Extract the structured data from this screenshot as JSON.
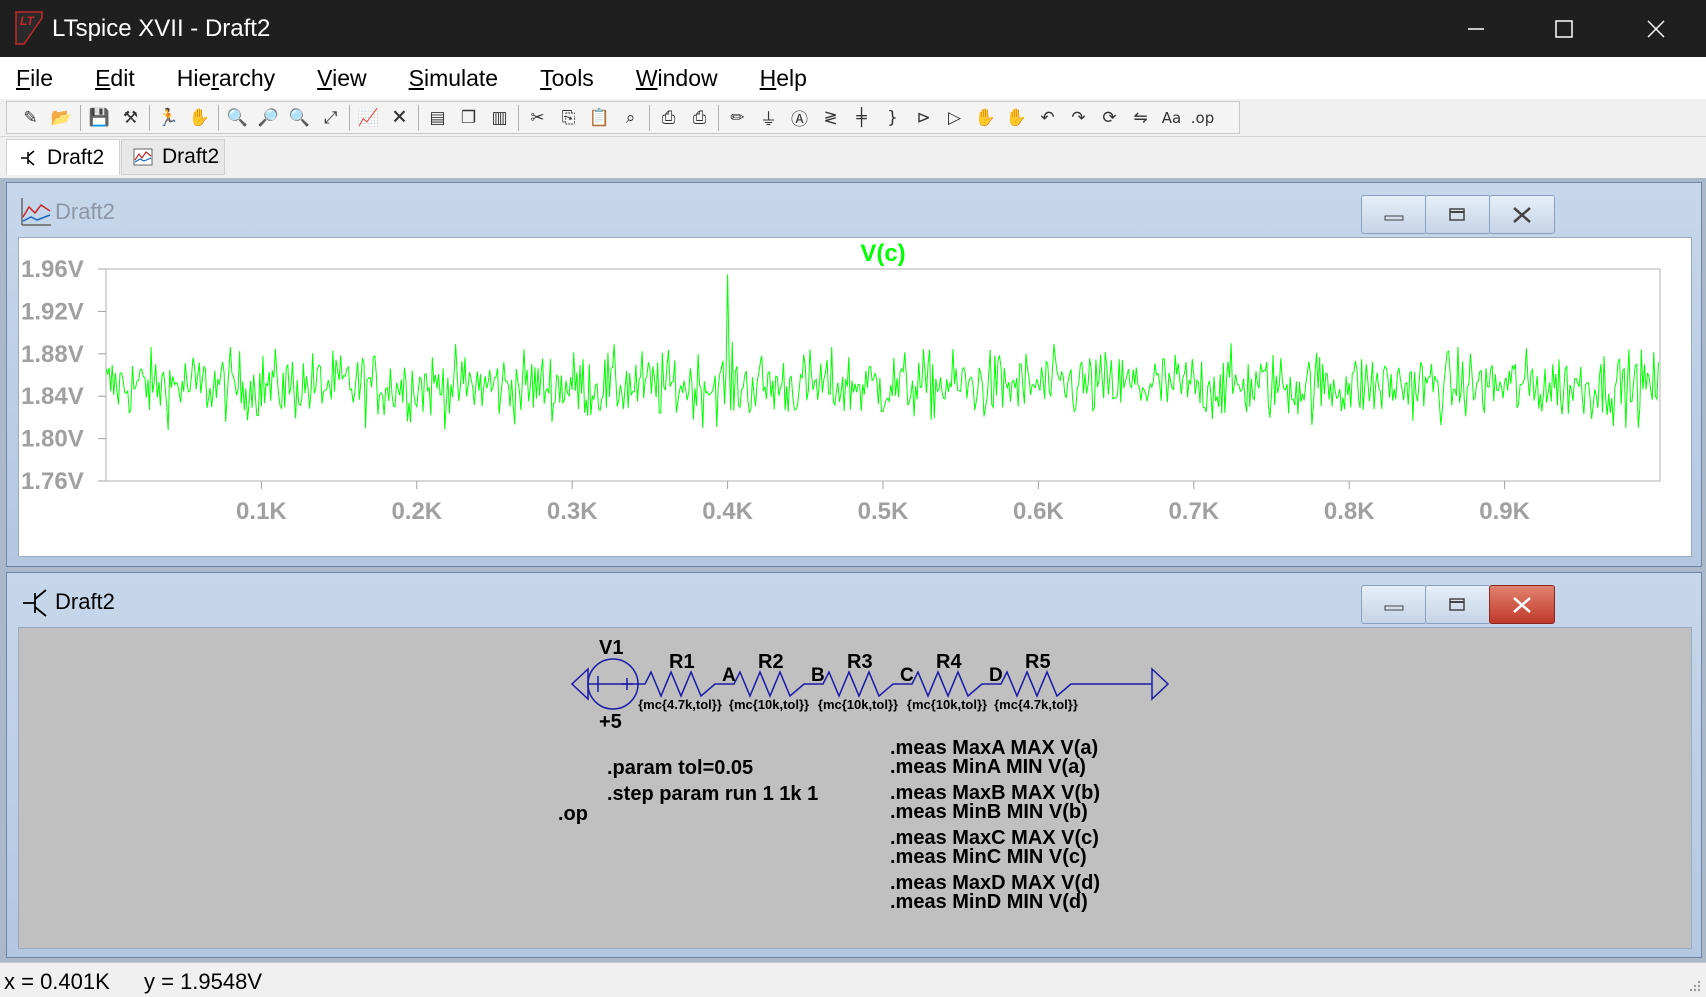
{
  "window": {
    "title": "LTspice XVII - Draft2"
  },
  "menu": [
    {
      "u": "F",
      "rest": "ile"
    },
    {
      "u": "E",
      "rest": "dit"
    },
    {
      "pre": "Hie",
      "u": "r",
      "rest": "archy"
    },
    {
      "u": "V",
      "rest": "iew"
    },
    {
      "u": "S",
      "rest": "imulate"
    },
    {
      "u": "T",
      "rest": "ools"
    },
    {
      "u": "W",
      "rest": "indow"
    },
    {
      "u": "H",
      "rest": "elp"
    }
  ],
  "toolbar": {
    "buttons": [
      "new-schematic-icon",
      "open-icon",
      "save-icon",
      "control-panel-icon",
      "run-icon",
      "halt-icon",
      "zoom-in-icon",
      "zoom-area-icon",
      "zoom-out-icon",
      "zoom-fit-icon",
      "autorange-icon",
      "delete-plot-icon",
      "tile-horizontal-icon",
      "cascade-icon",
      "tile-vertical-icon",
      "cut-icon",
      "copy-icon",
      "paste-icon",
      "find-icon",
      "print-icon",
      "print-preview-icon",
      "wire-icon",
      "ground-icon",
      "label-net-icon",
      "resistor-icon",
      "capacitor-icon",
      "inductor-icon",
      "diode-icon",
      "component-icon",
      "move-icon",
      "drag-icon",
      "undo-icon",
      "redo-icon",
      "rotate-icon",
      "mirror-icon",
      "text-icon",
      "spice-directive-icon"
    ]
  },
  "tabs": [
    {
      "label": "Draft2",
      "icon": "schematic-icon",
      "active": true
    },
    {
      "label": "Draft2",
      "icon": "waveform-icon",
      "active": false
    }
  ],
  "plot_window": {
    "title": "Draft2",
    "chart_data": {
      "type": "line",
      "title": "V(c)",
      "series": [
        {
          "name": "V(c)",
          "color": "#00ff00",
          "points": 1000,
          "mean": 1.85,
          "min": 1.758,
          "max": 1.955
        }
      ],
      "ylim": [
        1.76,
        1.96
      ],
      "yticks": [
        "1.96V",
        "1.92V",
        "1.88V",
        "1.84V",
        "1.80V",
        "1.76V"
      ],
      "xlim": [
        0,
        1000
      ],
      "xticks": [
        "0.1K",
        "0.2K",
        "0.3K",
        "0.4K",
        "0.5K",
        "0.6K",
        "0.7K",
        "0.8K",
        "0.9K"
      ],
      "grid": false
    }
  },
  "schematic_window": {
    "title": "Draft2",
    "source": {
      "name": "V1",
      "value": "+5"
    },
    "resistors": [
      {
        "name": "R1",
        "value": "{mc{4.7k,tol}}"
      },
      {
        "name": "R2",
        "value": "{mc{10k,tol}}"
      },
      {
        "name": "R3",
        "value": "{mc{10k,tol}}"
      },
      {
        "name": "R4",
        "value": "{mc{10k,tol}}"
      },
      {
        "name": "R5",
        "value": "{mc{4.7k,tol}}"
      }
    ],
    "nodes": [
      "A",
      "B",
      "C",
      "D"
    ],
    "directives": [
      ".param tol=0.05",
      ".step param run 1 1k 1",
      ".op"
    ],
    "meas": [
      ".meas MaxA MAX V(a)",
      ".meas MinA MIN V(a)",
      ".meas MaxB MAX V(b)",
      ".meas MinB MIN V(b)",
      ".meas MaxC MAX V(c)",
      ".meas MinC MIN V(c)",
      ".meas MaxD MAX V(d)",
      ".meas MinD MIN V(d)"
    ]
  },
  "status": {
    "x": "x = 0.401K",
    "y": "y = 1.9548V"
  }
}
